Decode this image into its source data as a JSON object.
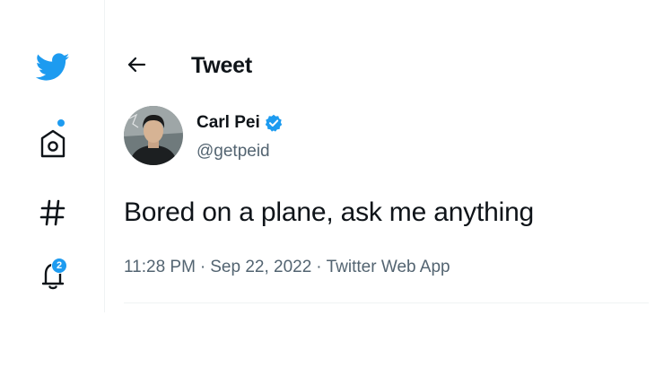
{
  "nav": {
    "items": [
      {
        "icon": "twitter-logo-icon"
      },
      {
        "icon": "home-icon",
        "has_dot": true
      },
      {
        "icon": "explore-hashtag-icon"
      },
      {
        "icon": "notifications-bell-icon",
        "badge": "2"
      }
    ]
  },
  "header": {
    "back_icon": "back-arrow-icon",
    "title": "Tweet"
  },
  "tweet": {
    "author": {
      "name": "Carl Pei",
      "handle": "@getpeid",
      "verified": true
    },
    "text": "Bored on a plane, ask me anything",
    "meta": {
      "time": "11:28 PM",
      "date": "Sep 22, 2022",
      "source": "Twitter Web App",
      "separator": "·"
    }
  },
  "colors": {
    "brand": "#1d9bf0",
    "text_primary": "#0f1419",
    "text_secondary": "#536471",
    "border": "#eff3f4"
  }
}
